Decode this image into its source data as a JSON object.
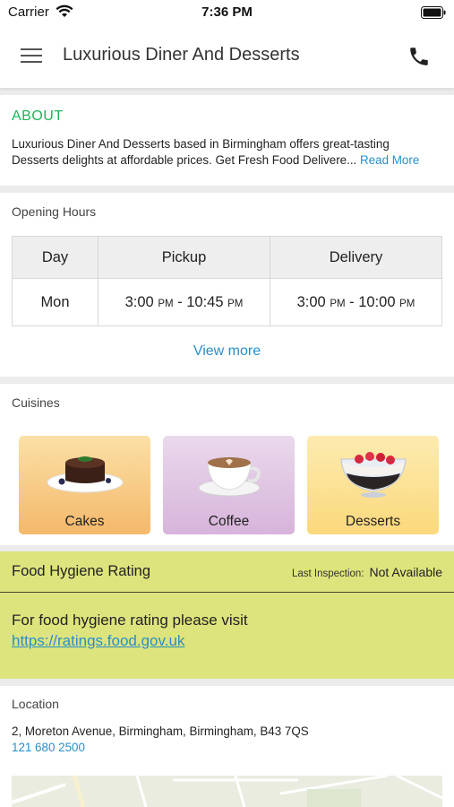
{
  "status_bar": {
    "carrier": "Carrier",
    "time": "7:36 PM"
  },
  "header": {
    "title": "Luxurious Diner And Desserts",
    "menu_icon": "hamburger-menu-icon",
    "phone_icon": "phone-icon"
  },
  "about": {
    "heading": "ABOUT",
    "line1": "Luxurious Diner And Desserts based in Birmingham offers great-tasting",
    "line2": "Desserts delights at affordable prices. Get Fresh Food Delivere...",
    "read_more": "Read More"
  },
  "opening_hours": {
    "title": "Opening Hours",
    "columns": [
      "Day",
      "Pickup",
      "Delivery"
    ],
    "rows": [
      {
        "day": "Mon",
        "pickup_start": "3:00",
        "pickup_start_ampm": "PM",
        "pickup_end": "10:45",
        "pickup_end_ampm": "PM",
        "delivery_start": "3:00",
        "delivery_start_ampm": "PM",
        "delivery_end": "10:00",
        "delivery_end_ampm": "PM"
      }
    ],
    "view_more": "View more"
  },
  "cuisines": {
    "title": "Cuisines",
    "items": [
      {
        "label": "Cakes",
        "image": "chocolate-cake-image"
      },
      {
        "label": "Coffee",
        "image": "coffee-cup-image"
      },
      {
        "label": "Desserts",
        "image": "dessert-bowl-image"
      }
    ]
  },
  "hygiene": {
    "title": "Food Hygiene Rating",
    "last_inspection_label": "Last Inspection:",
    "last_inspection_value": "Not Available",
    "text": "For food hygiene rating please visit",
    "link": "https://ratings.food.gov.uk"
  },
  "location": {
    "title": "Location",
    "address": "2, Moreton Avenue, Birmingham, Birmingham, B43 7QS",
    "phone": "121 680 2500"
  },
  "colors": {
    "accent_green": "#1fb45a",
    "link_blue": "#2a8fc6",
    "hygiene_bg": "#dde47d"
  }
}
